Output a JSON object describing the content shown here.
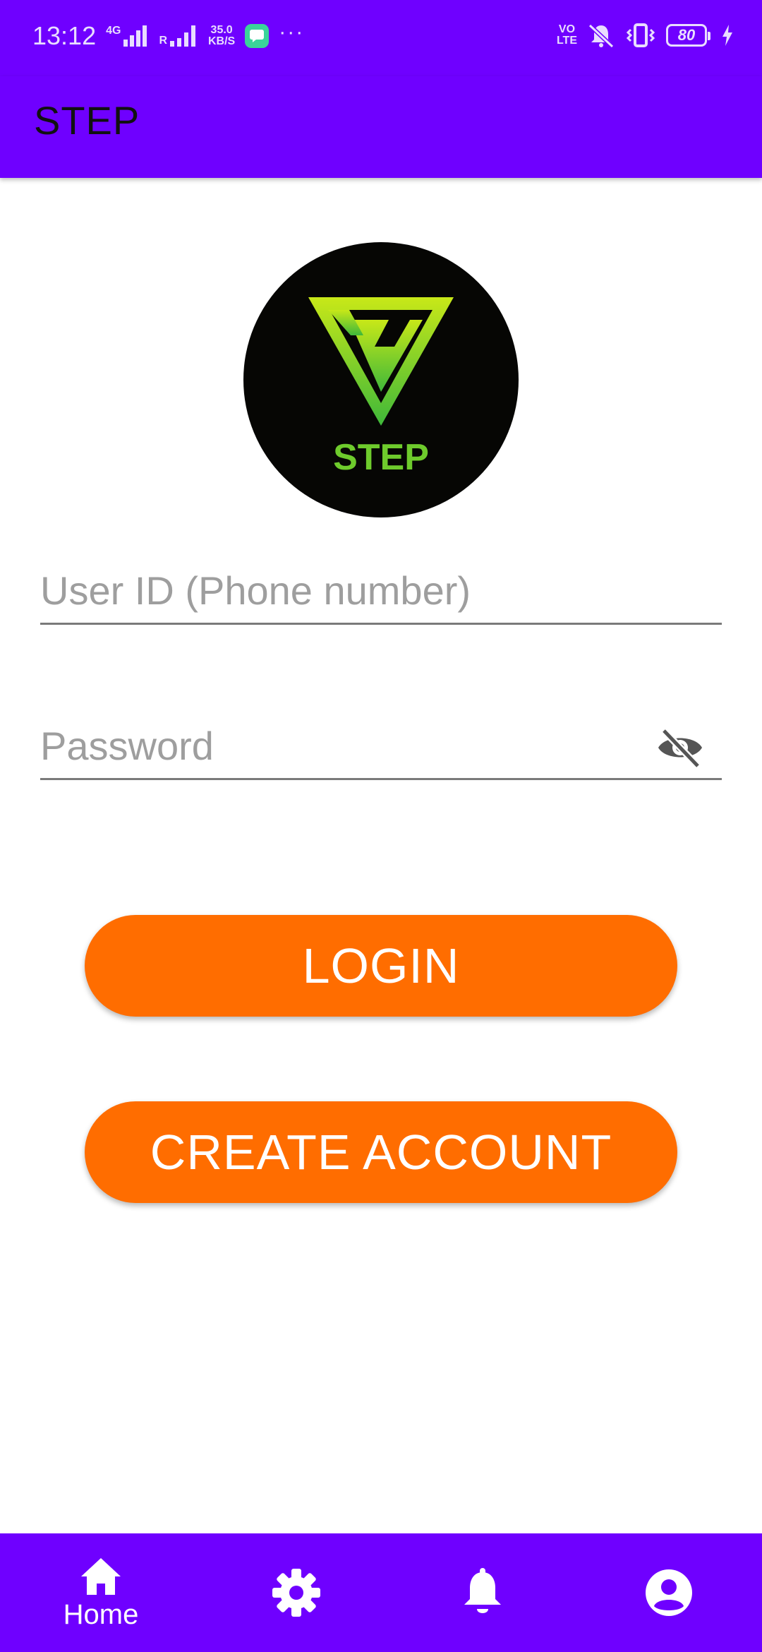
{
  "status_bar": {
    "time": "13:12",
    "network_type": "4G",
    "roaming": "R",
    "speed_value": "35.0",
    "speed_unit": "KB/S",
    "more": "···",
    "volte_top": "VO",
    "volte_bottom": "LTE",
    "battery": "80"
  },
  "app_bar": {
    "title": "STEP"
  },
  "logo": {
    "text": "STEP",
    "bg_color": "#060604",
    "accent_color": "#6ecb2c"
  },
  "form": {
    "user_id": {
      "placeholder": "User ID (Phone number)",
      "value": ""
    },
    "password": {
      "placeholder": "Password",
      "value": ""
    }
  },
  "buttons": {
    "login": "LOGIN",
    "create_account": "CREATE ACCOUNT"
  },
  "bottom_nav": {
    "items": [
      {
        "label": "Home",
        "icon": "home-icon",
        "selected": true
      },
      {
        "label": "",
        "icon": "settings-icon"
      },
      {
        "label": "",
        "icon": "notifications-icon"
      },
      {
        "label": "",
        "icon": "account-icon"
      }
    ]
  },
  "colors": {
    "primary": "#6f00ff",
    "button": "#ff6d00"
  }
}
